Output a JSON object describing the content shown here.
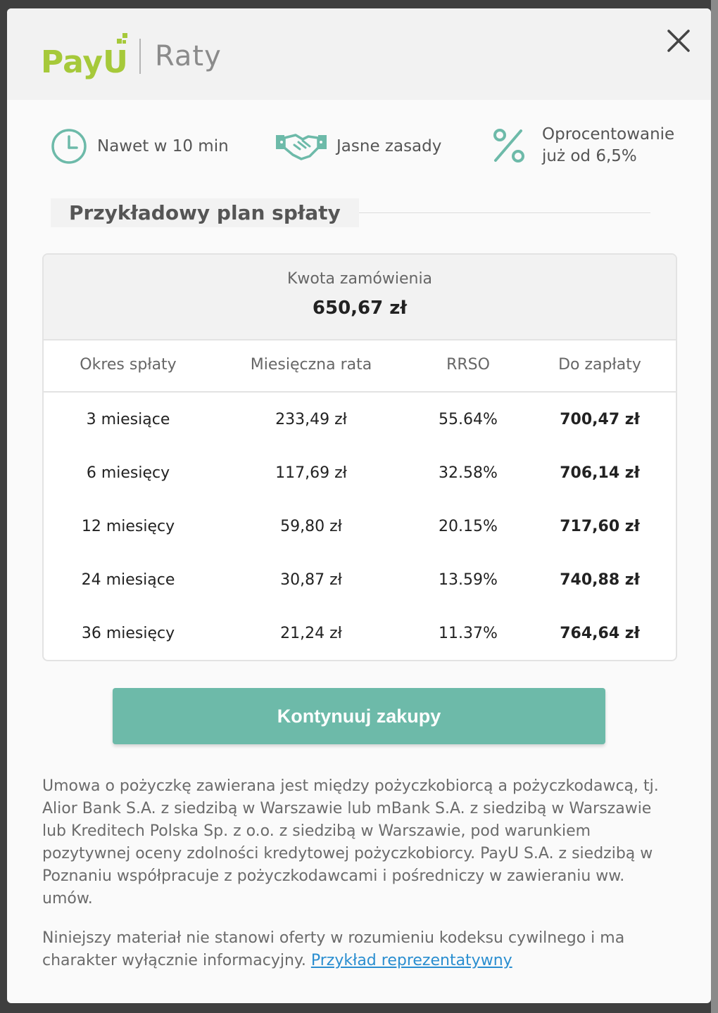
{
  "header": {
    "logo_text": "PayU",
    "brand_suffix": "Raty",
    "close_label": "close"
  },
  "features": [
    {
      "icon": "clock-icon",
      "text": "Nawet w 10 min"
    },
    {
      "icon": "handshake-icon",
      "text": "Jasne zasady"
    },
    {
      "icon": "percent-icon",
      "line1": "Oprocentowanie",
      "line2": "już od 6,5%"
    }
  ],
  "plan": {
    "title": "Przykładowy plan spłaty",
    "amount_label": "Kwota zamówienia",
    "amount_value": "650,67 zł",
    "columns": [
      "Okres spłaty",
      "Miesięczna rata",
      "RRSO",
      "Do zapłaty"
    ],
    "rows": [
      {
        "period": "3 miesiące",
        "monthly": "233,49 zł",
        "rrso": "55.64%",
        "total": "700,47 zł"
      },
      {
        "period": "6 miesięcy",
        "monthly": "117,69 zł",
        "rrso": "32.58%",
        "total": "706,14 zł"
      },
      {
        "period": "12 miesięcy",
        "monthly": "59,80 zł",
        "rrso": "20.15%",
        "total": "717,60 zł"
      },
      {
        "period": "24 miesiące",
        "monthly": "30,87 zł",
        "rrso": "13.59%",
        "total": "740,88 zł"
      },
      {
        "period": "36 miesięcy",
        "monthly": "21,24 zł",
        "rrso": "11.37%",
        "total": "764,64 zł"
      }
    ]
  },
  "cta": {
    "label": "Kontynuuj zakupy"
  },
  "legal": {
    "paragraph1": "Umowa o pożyczkę zawierana jest między pożyczkobiorcą a pożyczkodawcą, tj. Alior Bank S.A. z siedzibą w Warszawie lub mBank S.A. z siedzibą w Warszawie lub Kreditech Polska Sp. z o.o. z siedzibą w Warszawie, pod warunkiem pozytywnej oceny zdolności kredytowej pożyczkobiorcy. PayU S.A. z siedzibą w Poznaniu współpracuje z pożyczkodawcami i pośredniczy w zawieraniu ww. umów.",
    "paragraph2": "Niniejszy materiał nie stanowi oferty w rozumieniu kodeksu cywilnego i ma charakter wyłącznie informacyjny.",
    "link_text": "Przykład reprezentatywny"
  },
  "colors": {
    "accent": "#6dbaa9",
    "logo_green": "#a6c93a",
    "link": "#2a8ed0"
  }
}
